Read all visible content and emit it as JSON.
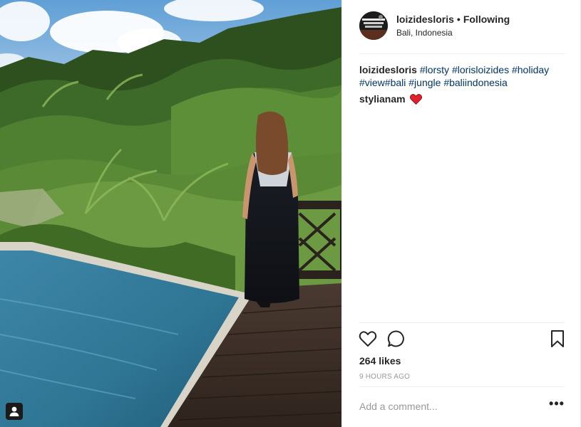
{
  "post": {
    "username": "loizidesloris",
    "separator": "•",
    "follow_state": "Following",
    "location": "Bali, Indonesia",
    "caption": {
      "username": "loizidesloris",
      "hashtags": [
        "#lorsty",
        "#lorisloizides",
        "#holiday",
        "#view#bali",
        "#jungle",
        "#baliindonesia"
      ]
    },
    "comments": [
      {
        "username": "stylianam",
        "emoji": "heart-emoji"
      }
    ],
    "likes": "264 likes",
    "time": "9 HOURS AGO",
    "add_comment_placeholder": "Add a comment...",
    "more_label": "•••"
  },
  "icons": {
    "like": "heart-outline-icon",
    "comment": "speech-bubble-icon",
    "save": "bookmark-icon",
    "tagged_users": "person-tag-icon"
  },
  "colors": {
    "text": "#262626",
    "hashtag": "#003569",
    "muted": "#999999",
    "heart": "#ed4956",
    "divider": "#efefef"
  }
}
